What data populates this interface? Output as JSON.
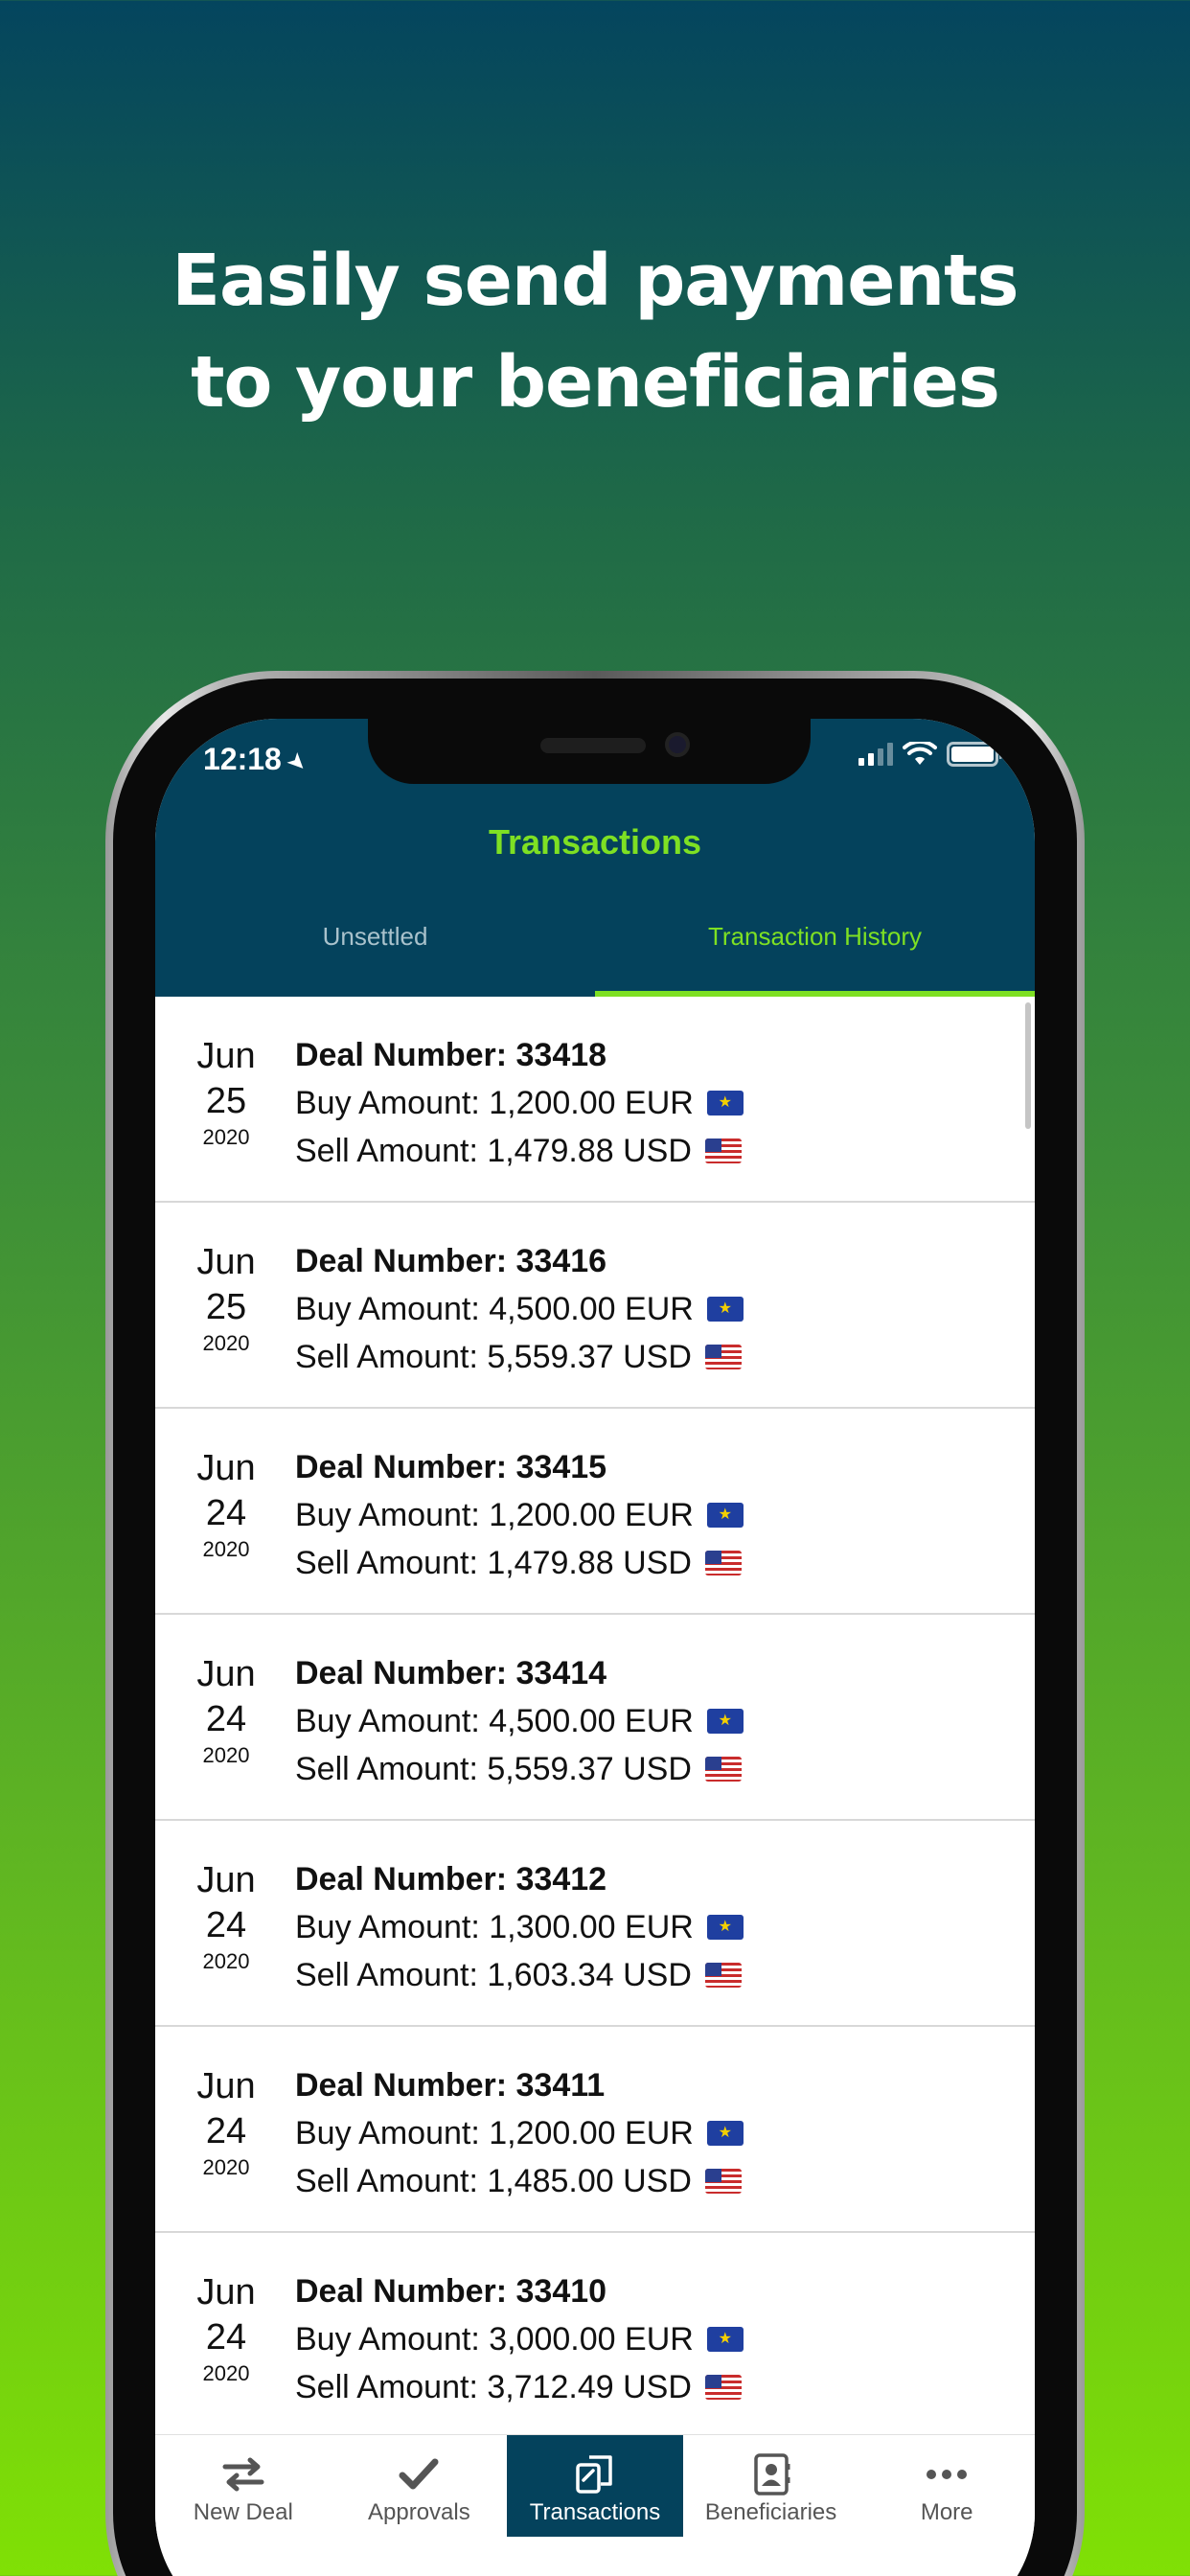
{
  "headline": {
    "line1": "Easily send payments",
    "line2": "to your beneficiaries"
  },
  "status_bar": {
    "time": "12:18",
    "location_arrow": "➤"
  },
  "app": {
    "title": "Transactions",
    "tabs": [
      {
        "label": "Unsettled",
        "active": false
      },
      {
        "label": "Transaction History",
        "active": true
      }
    ]
  },
  "transactions": [
    {
      "month": "Jun",
      "day": "25",
      "year": "2020",
      "deal": "Deal Number: 33418",
      "buy": "Buy Amount: 1,200.00 EUR",
      "sell": "Sell Amount: 1,479.88 USD"
    },
    {
      "month": "Jun",
      "day": "25",
      "year": "2020",
      "deal": "Deal Number: 33416",
      "buy": "Buy Amount: 4,500.00 EUR",
      "sell": "Sell Amount: 5,559.37 USD"
    },
    {
      "month": "Jun",
      "day": "24",
      "year": "2020",
      "deal": "Deal Number: 33415",
      "buy": "Buy Amount: 1,200.00 EUR",
      "sell": "Sell Amount: 1,479.88 USD"
    },
    {
      "month": "Jun",
      "day": "24",
      "year": "2020",
      "deal": "Deal Number: 33414",
      "buy": "Buy Amount: 4,500.00 EUR",
      "sell": "Sell Amount: 5,559.37 USD"
    },
    {
      "month": "Jun",
      "day": "24",
      "year": "2020",
      "deal": "Deal Number: 33412",
      "buy": "Buy Amount: 1,300.00 EUR",
      "sell": "Sell Amount: 1,603.34 USD"
    },
    {
      "month": "Jun",
      "day": "24",
      "year": "2020",
      "deal": "Deal Number: 33411",
      "buy": "Buy Amount: 1,200.00 EUR",
      "sell": "Sell Amount: 1,485.00 USD"
    },
    {
      "month": "Jun",
      "day": "24",
      "year": "2020",
      "deal": "Deal Number: 33410",
      "buy": "Buy Amount: 3,000.00 EUR",
      "sell": "Sell Amount: 3,712.49 USD"
    }
  ],
  "tabbar": [
    {
      "label": "New Deal",
      "icon": "exchange-arrows-icon",
      "active": false
    },
    {
      "label": "Approvals",
      "icon": "checkmark-icon",
      "active": false
    },
    {
      "label": "Transactions",
      "icon": "documents-icon",
      "active": true
    },
    {
      "label": "Beneficiaries",
      "icon": "contact-card-icon",
      "active": false
    },
    {
      "label": "More",
      "icon": "more-dots-icon",
      "active": false
    }
  ],
  "colors": {
    "header_bg": "#04425c",
    "accent": "#7ee023",
    "inactive_tab": "#a9c2cc"
  }
}
